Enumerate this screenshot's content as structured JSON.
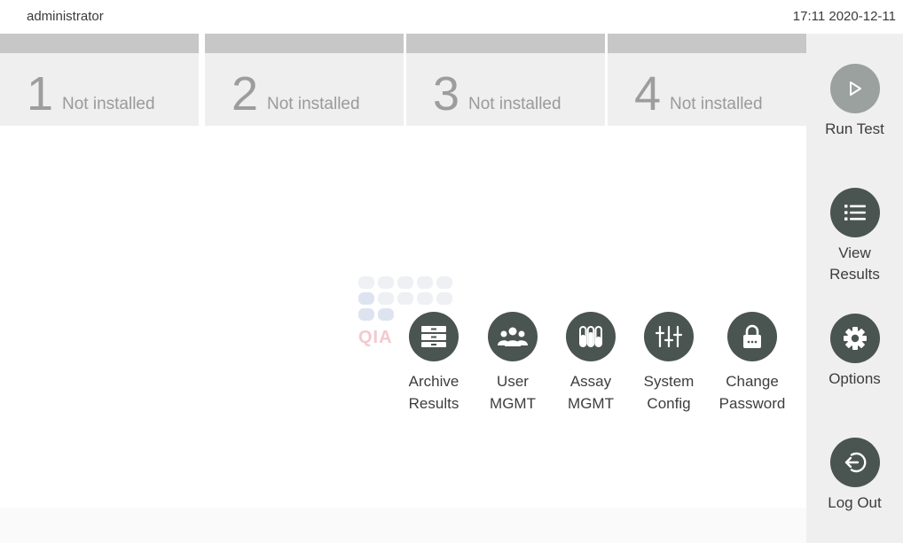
{
  "header": {
    "user": "administrator",
    "datetime": "17:11 2020-12-11"
  },
  "modules": [
    {
      "number": "1",
      "status": "Not installed"
    },
    {
      "number": "2",
      "status": "Not installed"
    },
    {
      "number": "3",
      "status": "Not installed"
    },
    {
      "number": "4",
      "status": "Not installed"
    }
  ],
  "sidebar": {
    "run_test": "Run Test",
    "view_results_line1": "View",
    "view_results_line2": "Results",
    "options": "Options",
    "log_out": "Log Out"
  },
  "watermark": {
    "text": "QIA"
  },
  "tools": [
    {
      "line1": "Archive",
      "line2": "Results",
      "icon": "archive-icon"
    },
    {
      "line1": "User",
      "line2": "MGMT",
      "icon": "users-icon"
    },
    {
      "line1": "Assay",
      "line2": "MGMT",
      "icon": "test-tubes-icon"
    },
    {
      "line1": "System",
      "line2": "Config",
      "icon": "sliders-icon"
    },
    {
      "line1": "Change",
      "line2": "Password",
      "icon": "padlock-icon"
    }
  ],
  "colors": {
    "icon_dark": "#4a5450",
    "play_circle": "#9aa19e",
    "sidebar_bg": "#efefef",
    "module_cap": "#c7c7c7"
  }
}
